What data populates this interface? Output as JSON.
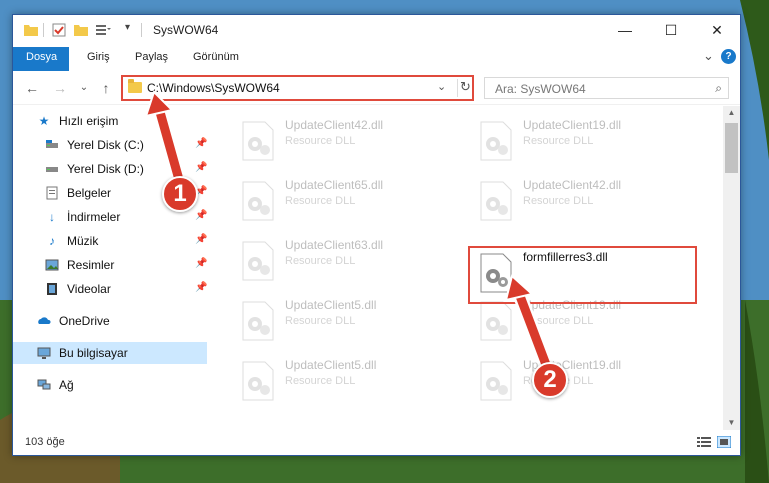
{
  "window": {
    "title": "SysWOW64",
    "controls": {
      "minimize": "—",
      "maximize": "☐",
      "close": "✕"
    }
  },
  "ribbon": {
    "tabs": [
      "Dosya",
      "Giriş",
      "Paylaş",
      "Görünüm"
    ],
    "expand": "⌄",
    "help": "?"
  },
  "nav": {
    "back": "←",
    "forward": "→",
    "recent": "⌄",
    "up": "↑",
    "address": "C:\\Windows\\SysWOW64",
    "address_chevron": "⌄",
    "refresh": "↻",
    "search_placeholder": "Ara: SysWOW64",
    "search_icon": "⌕"
  },
  "sidebar": {
    "items": [
      {
        "label": "Hızlı erişim",
        "icon": "star-icon",
        "pinned": false
      },
      {
        "label": "Yerel Disk (C:)",
        "icon": "drive-c-icon",
        "pinned": true
      },
      {
        "label": "Yerel Disk (D:)",
        "icon": "drive-d-icon",
        "pinned": true
      },
      {
        "label": "Belgeler",
        "icon": "documents-icon",
        "pinned": true
      },
      {
        "label": "İndirmeler",
        "icon": "downloads-icon",
        "pinned": true
      },
      {
        "label": "Müzik",
        "icon": "music-icon",
        "pinned": true
      },
      {
        "label": "Resimler",
        "icon": "pictures-icon",
        "pinned": true
      },
      {
        "label": "Videolar",
        "icon": "videos-icon",
        "pinned": true
      },
      {
        "label": "OneDrive",
        "icon": "onedrive-icon",
        "pinned": false
      },
      {
        "label": "Bu bilgisayar",
        "icon": "this-pc-icon",
        "pinned": false,
        "selected": true
      },
      {
        "label": "Ağ",
        "icon": "network-icon",
        "pinned": false
      }
    ]
  },
  "files": {
    "left_column": [
      {
        "name": "UpdateClient42.dll",
        "desc": "Resource DLL"
      },
      {
        "name": "UpdateClient65.dll",
        "desc": "Resource DLL"
      },
      {
        "name": "UpdateClient63.dll",
        "desc": "Resource DLL"
      },
      {
        "name": "UpdateClient5.dll",
        "desc": "Resource DLL"
      },
      {
        "name": "UpdateClient5.dll",
        "desc": "Resource DLL"
      }
    ],
    "right_column": [
      {
        "name": "UpdateClient19.dll",
        "desc": "Resource DLL"
      },
      {
        "name": "UpdateClient42.dll",
        "desc": "Resource DLL"
      },
      {
        "name": "formfillerres3.dll",
        "desc": "",
        "highlighted": true
      },
      {
        "name": "UpdateClient19.dll",
        "desc": "Resource DLL"
      },
      {
        "name": "UpdateClient19.dll",
        "desc": "Resource DLL"
      }
    ]
  },
  "status": {
    "count": "103 öğe"
  },
  "callouts": {
    "first": "1",
    "second": "2"
  },
  "colors": {
    "accent": "#1979ca",
    "highlight": "#e04a3c",
    "callout": "#d93a2b",
    "selected": "#cce8ff"
  }
}
